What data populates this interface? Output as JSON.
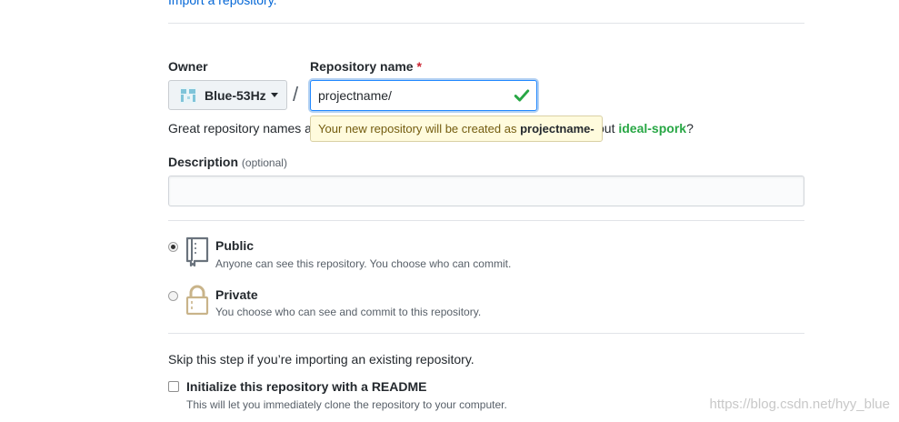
{
  "top_link": "Import a repository.",
  "owner": {
    "label": "Owner",
    "name": "Blue-53Hz"
  },
  "separator": "/",
  "repository": {
    "label": "Repository name",
    "required_mark": "*",
    "value": "projectname/"
  },
  "tooltip": {
    "prefix": "Your new repository will be created as ",
    "name": "projectname-"
  },
  "suggestion": {
    "lead": "Great repository names a",
    "tail_prefix": "out ",
    "suggested_name": "ideal-spork",
    "tail_suffix": "?"
  },
  "description": {
    "label": "Description",
    "optional": "(optional)",
    "value": ""
  },
  "visibility": {
    "selected": "public",
    "public": {
      "title": "Public",
      "desc": "Anyone can see this repository. You choose who can commit.",
      "icon": "repo-book-icon"
    },
    "private": {
      "title": "Private",
      "desc": "You choose who can see and commit to this repository.",
      "icon": "lock-icon"
    }
  },
  "init": {
    "skip_text": "Skip this step if you’re importing an existing repository.",
    "readme_label": "Initialize this repository with a README",
    "readme_desc": "This will let you immediately clone the repository to your computer.",
    "checked": false
  },
  "watermark": "https://blog.csdn.net/hyy_blue",
  "colors": {
    "link": "#0366d6",
    "success": "#28a745",
    "required": "#cb2431",
    "tooltip_bg": "#fffbdd",
    "focus_border": "#2188ff"
  }
}
